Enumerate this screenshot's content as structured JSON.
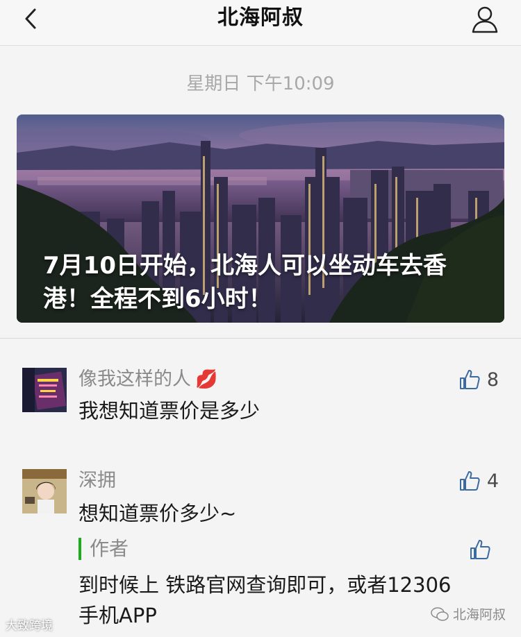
{
  "header": {
    "title": "北海阿叔"
  },
  "timestamp": "星期日 下午10:09",
  "article": {
    "title": "7月10日开始，北海人可以坐动车去香港！全程不到6小时！"
  },
  "comments": [
    {
      "nickname": "像我这样的人",
      "text": "我想知道票价是多少",
      "likes": "8"
    },
    {
      "nickname": "深拥",
      "text": "想知道票价多少~",
      "likes": "4",
      "reply": {
        "label": "作者",
        "text": "到时候上 铁路官网查询即可，或者12306手机APP"
      }
    }
  ],
  "watermarks": {
    "left": "大致跨境",
    "right": "北海阿叔"
  }
}
